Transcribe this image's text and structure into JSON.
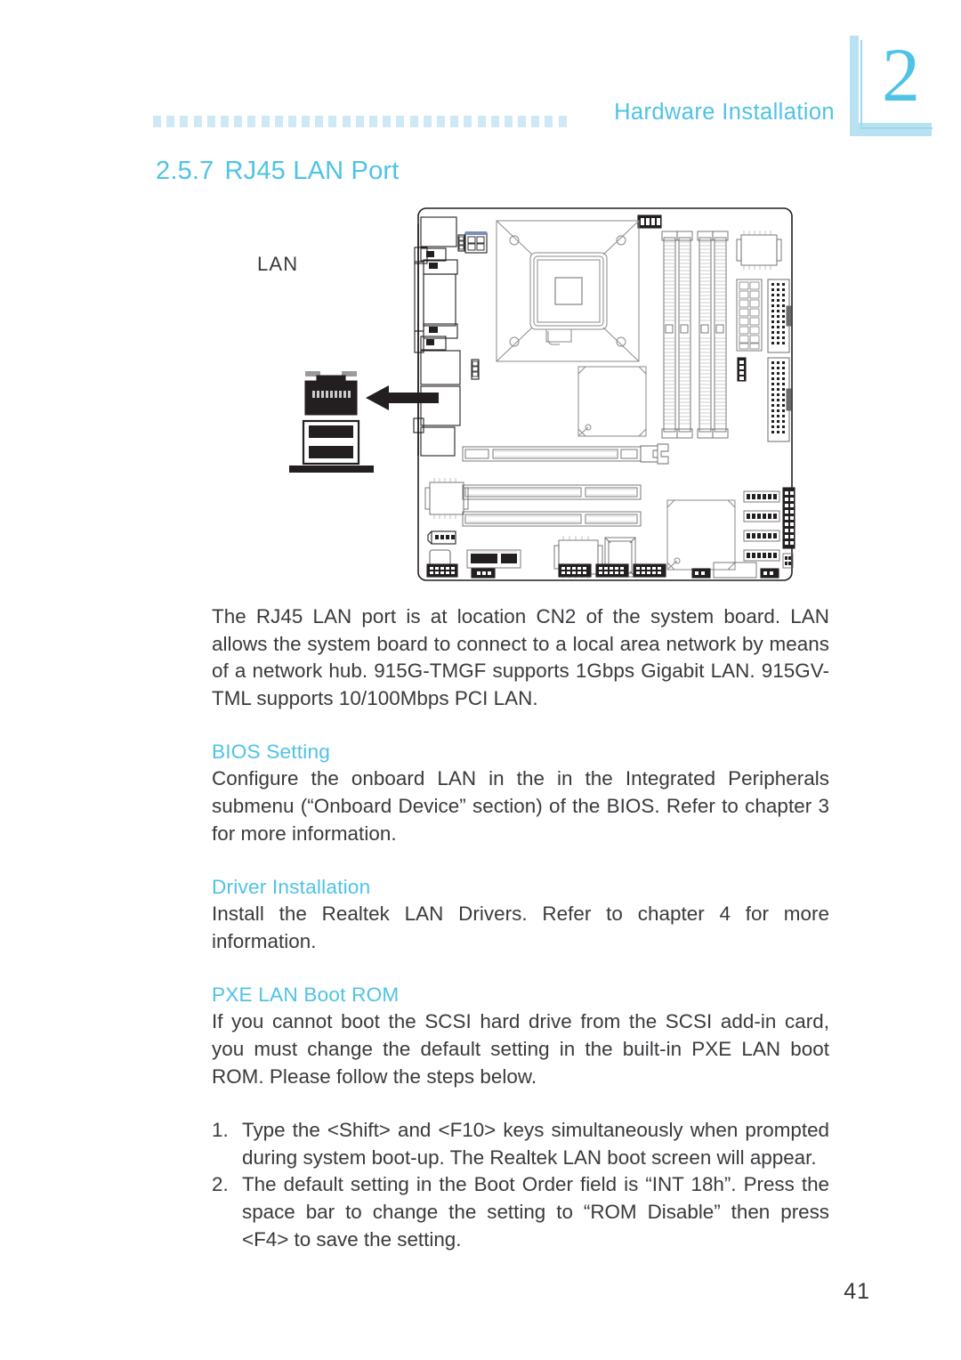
{
  "header": {
    "title": "Hardware Installation",
    "chapter_number": "2",
    "rule_icon": "dotted-square-rule"
  },
  "section": {
    "number": "2.5.7",
    "title": "RJ45 LAN Port"
  },
  "figure": {
    "caption_label": "LAN",
    "arrow_icon": "left-arrow-icon",
    "connector_icon": "rj45-lan-usb-stack-icon",
    "board_icon": "system-board-diagram"
  },
  "content": {
    "intro": "The RJ45 LAN port is at location CN2 of the system board. LAN allows the system board to connect to a local area network by means of a network hub. 915G-TMGF supports 1Gbps Gigabit LAN. 915GV-TML supports 10/100Mbps PCI LAN.",
    "bios_heading": "BIOS Setting",
    "bios_body": "Configure the onboard LAN in the in the Integrated Peripherals submenu (“Onboard Device” section) of the BIOS. Refer to chapter 3 for more information.",
    "driver_heading": "Driver Installation",
    "driver_body": "Install the Realtek LAN Drivers. Refer to chapter 4 for more information.",
    "pxe_heading": "PXE LAN Boot ROM",
    "pxe_body": "If you cannot boot the SCSI hard drive from the SCSI add-in card, you must change the default setting in the built-in PXE LAN boot ROM. Please follow the steps below.",
    "steps": [
      {
        "marker": "1.",
        "text": "Type the <Shift> and <F10> keys simultaneously when prompted during system boot-up. The Realtek LAN boot screen will appear."
      },
      {
        "marker": "2.",
        "text": "The default setting in the Boot Order field is “INT 18h”. Press the space bar to change the setting to “ROM Disable” then press <F4> to save the setting."
      }
    ]
  },
  "footer": {
    "page_number": "41"
  },
  "colors": {
    "accent": "#4ec3e6",
    "accent_light": "#b8e2f2",
    "rule": "#cfe8f5",
    "text": "#3a3a3e",
    "line": "#231f20"
  }
}
